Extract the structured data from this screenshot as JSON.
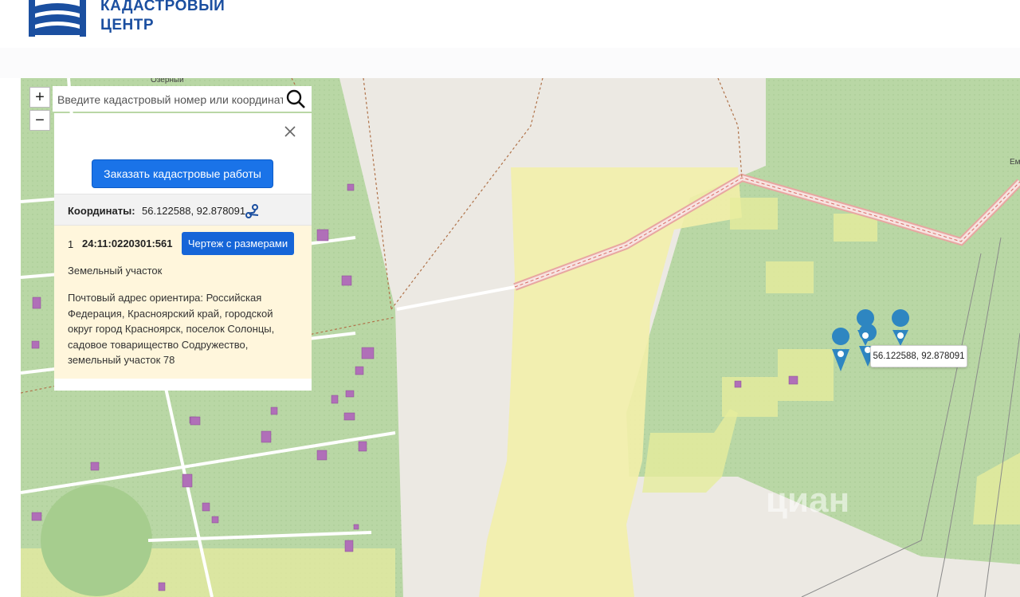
{
  "header": {
    "logo_line1": "КАДАСТРОВЫЙ",
    "logo_line2": "ЦЕНТР",
    "brand_color": "#1b4fa0"
  },
  "map": {
    "zoom_in_label": "+",
    "zoom_out_label": "−",
    "search": {
      "placeholder": "Введите кадастровый номер или координаты"
    },
    "street_label": "Озерный",
    "corner_label": "Ем",
    "watermark": "циан",
    "marker_color": "#2e86c1"
  },
  "popup": {
    "order_button": "Заказать кадастровые работы",
    "coordinates_label": "Координаты:",
    "coordinates_value": "56.122588, 92.878091",
    "parcel": {
      "index": "1",
      "number": "24:11:0220301:561",
      "drawing_button": "Чертеж с размерами",
      "type": "Земельный участок",
      "address": "Почтовый адрес ориентира: Российская Федерация, Красноярский край, городской округ город Красноярск, поселок Солонцы, садовое товарищество Содружество, земельный участок 78"
    }
  },
  "tooltip": {
    "text": "56.122588, 92.878091"
  }
}
